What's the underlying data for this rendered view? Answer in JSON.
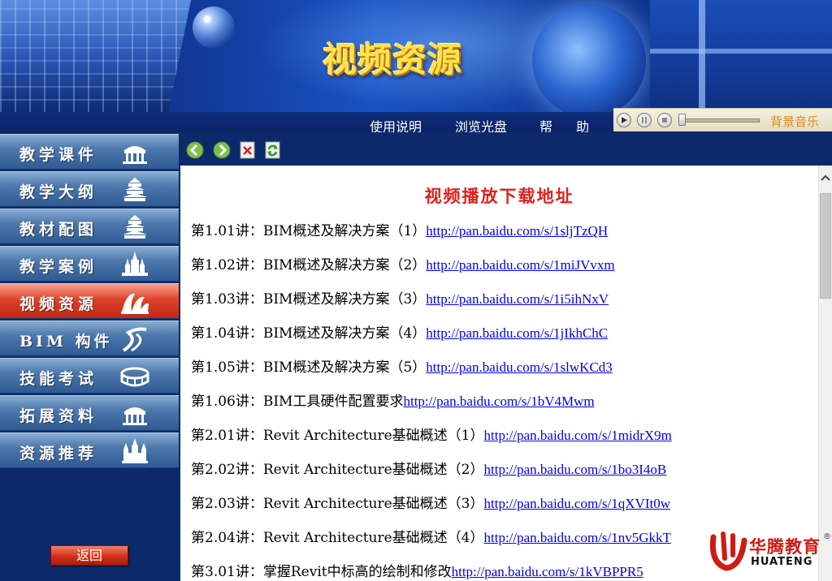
{
  "header": {
    "title": "视频资源",
    "nav": [
      "使用说明",
      "浏览光盘",
      "帮 助"
    ],
    "music_label": "背景音乐"
  },
  "sidebar": {
    "items": [
      {
        "label": "教学课件",
        "icon": "building-icon"
      },
      {
        "label": "教学大纲",
        "icon": "temple-icon"
      },
      {
        "label": "教材配图",
        "icon": "temple-icon"
      },
      {
        "label": "教学案例",
        "icon": "castle-icon"
      },
      {
        "label": "视频资源",
        "icon": "opera-house-icon",
        "active": true
      },
      {
        "label": "BIM 构件",
        "icon": "highway-icon"
      },
      {
        "label": "技能考试",
        "icon": "stadium-icon"
      },
      {
        "label": "拓展资料",
        "icon": "building-icon"
      },
      {
        "label": "资源推荐",
        "icon": "cathedral-icon"
      }
    ],
    "back_label": "返回"
  },
  "content": {
    "title": "视频播放下载地址",
    "rows": [
      {
        "label": "第1.01讲：BIM概述及解决方案（1）",
        "url": "http://pan.baidu.com/s/1sljTzQH"
      },
      {
        "label": "第1.02讲：BIM概述及解决方案（2）",
        "url": "http://pan.baidu.com/s/1miJVvxm"
      },
      {
        "label": "第1.03讲：BIM概述及解决方案（3）",
        "url": "http://pan.baidu.com/s/1i5ihNxV"
      },
      {
        "label": "第1.04讲：BIM概述及解决方案（4）",
        "url": "http://pan.baidu.com/s/1jIkhChC"
      },
      {
        "label": "第1.05讲：BIM概述及解决方案（5）",
        "url": "http://pan.baidu.com/s/1slwKCd3"
      },
      {
        "label": "第1.06讲：BIM工具硬件配置要求",
        "url": "http://pan.baidu.com/s/1bV4Mwm"
      },
      {
        "label": "第2.01讲：Revit Architecture基础概述（1）",
        "url": "http://pan.baidu.com/s/1midrX9m"
      },
      {
        "label": "第2.02讲：Revit Architecture基础概述（2）",
        "url": "http://pan.baidu.com/s/1bo3I4oB"
      },
      {
        "label": "第2.03讲：Revit Architecture基础概述（3）",
        "url": "http://pan.baidu.com/s/1qXVIt0w"
      },
      {
        "label": "第2.04讲：Revit Architecture基础概述（4）",
        "url": "http://pan.baidu.com/s/1nv5GkkT"
      },
      {
        "label": "第3.01讲：掌握Revit中标高的绘制和修改",
        "url": "http://pan.baidu.com/s/1kVBPPR5"
      }
    ]
  },
  "logo": {
    "name_cn": "华腾教育",
    "name_en": "HUATENG",
    "reg": "®"
  },
  "colors": {
    "banner_blue": "#123b9b",
    "title_yellow": "#ffe14a",
    "active_red": "#e0412a",
    "heading_red": "#e0201e",
    "link_blue": "#0000ee"
  }
}
